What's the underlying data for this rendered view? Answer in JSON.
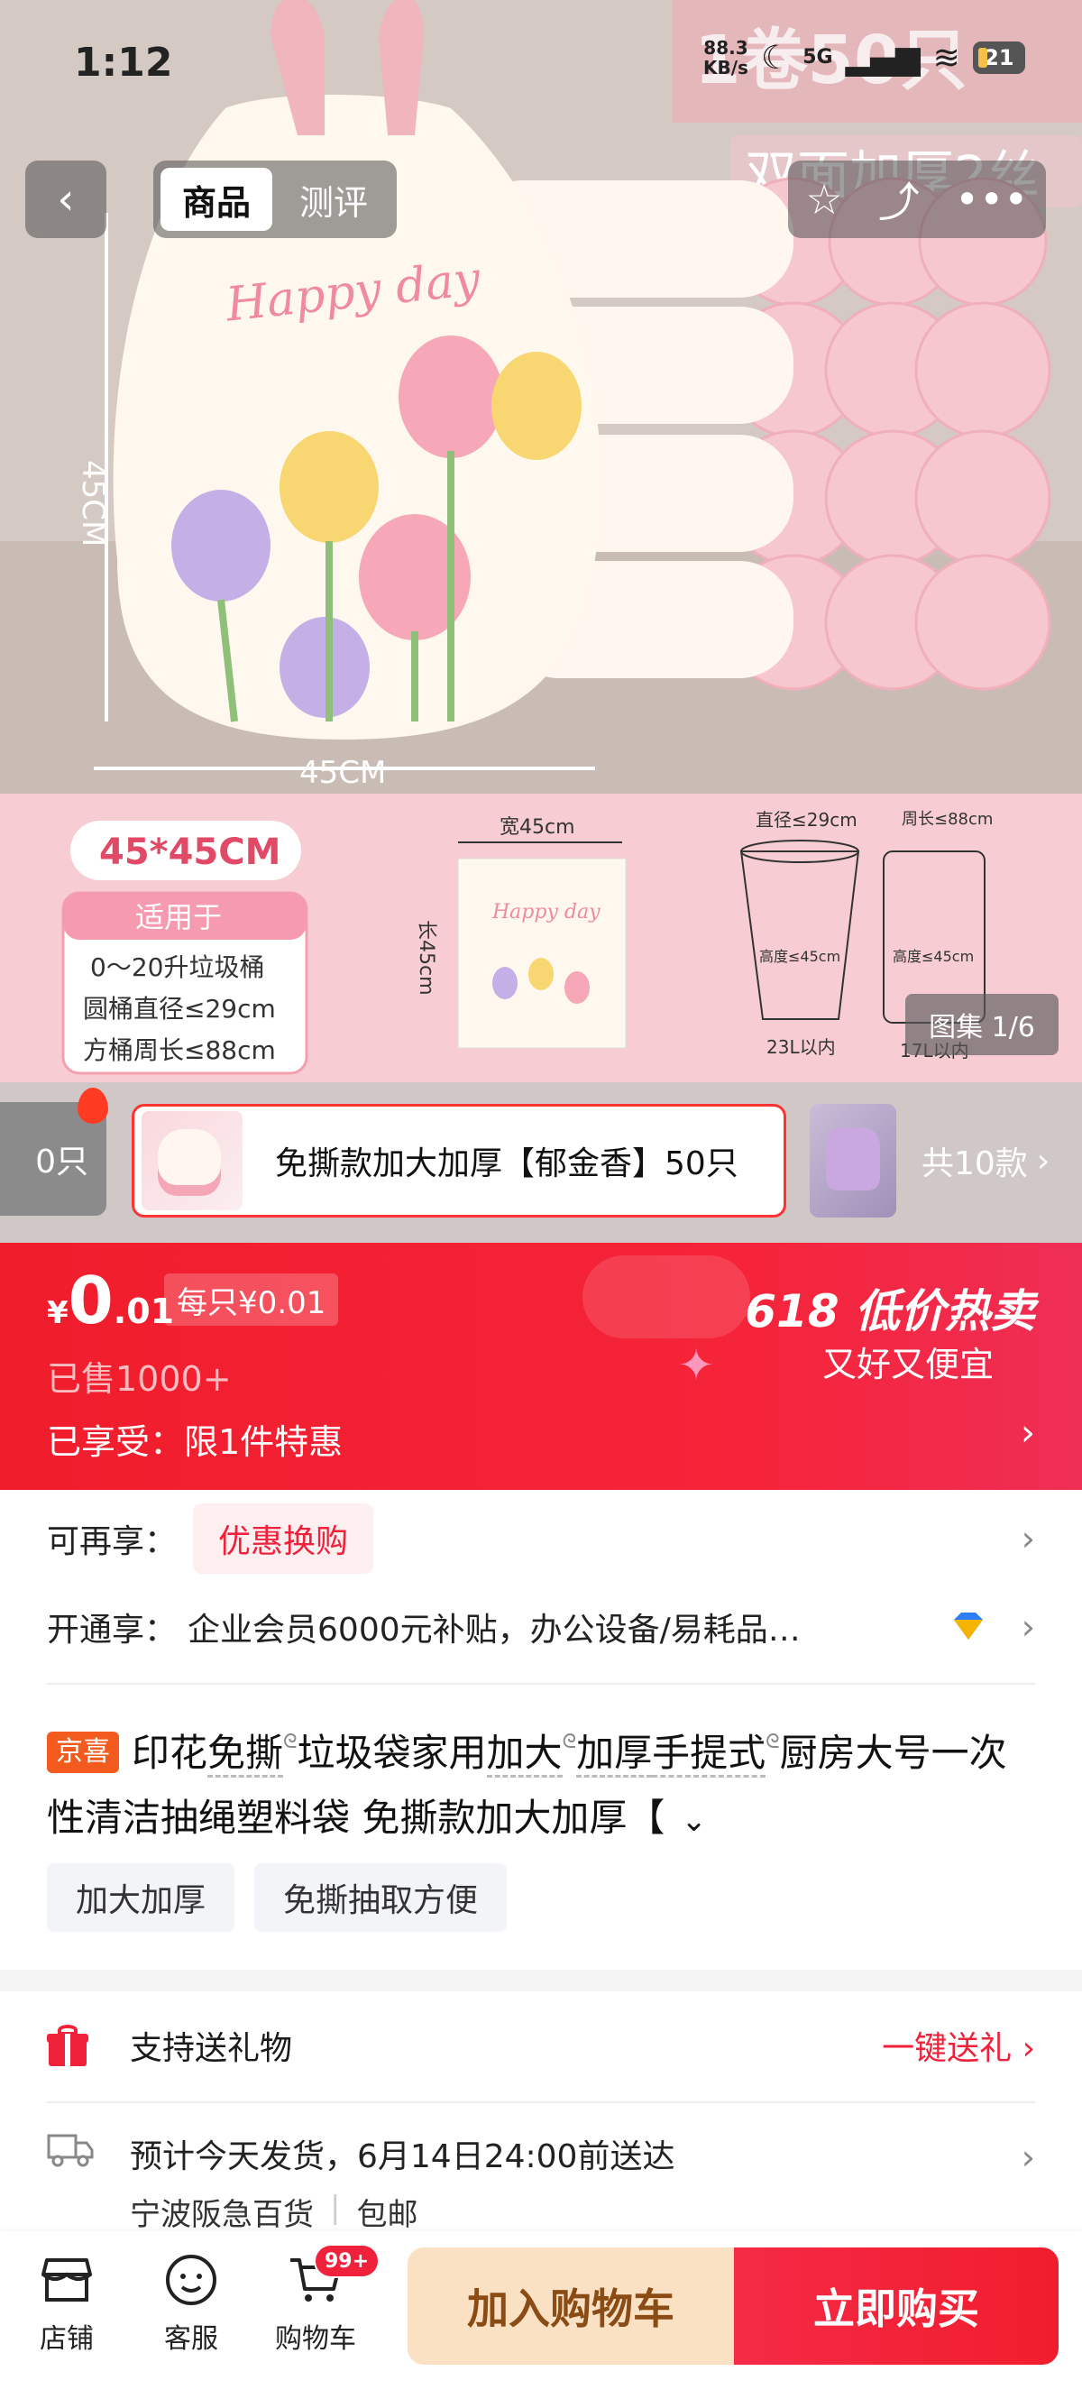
{
  "status_bar": {
    "time": "1:12",
    "net_speed_value": "88.3",
    "net_speed_unit": "KB/s",
    "network": "5G",
    "battery": "21"
  },
  "nav": {
    "tabs": [
      {
        "label": "商品",
        "active": true
      },
      {
        "label": "测评",
        "active": false
      }
    ]
  },
  "hero": {
    "overlay_text_top": "1卷50只",
    "overlay_text_sub": "双面加厚2丝",
    "bag_print": "Happy day",
    "height_dim": "45CM",
    "width_dim": "45CM",
    "spec": {
      "size": "45*45CM",
      "applies_title": "适用于",
      "applies_lines": [
        "0～20升垃圾桶",
        "圆桶直径≤29cm",
        "方桶周长≤88cm"
      ],
      "bag_width": "宽45cm",
      "bag_length": "长45cm",
      "round_diameter": "直径≤29cm",
      "round_height": "高度≤45cm",
      "round_volume": "23L以内",
      "square_perimeter": "周长≤88cm",
      "square_height": "高度≤45cm",
      "square_volume": "17L以内"
    },
    "gallery_counter": "图集 1/6"
  },
  "sku": {
    "prev_label": "0只",
    "current_label": "免撕款加大加厚【郁金香】50只",
    "total_label": "共10款"
  },
  "price": {
    "currency": "¥",
    "integer": "0",
    "decimal": ".01",
    "unit_price": "每只¥0.01",
    "sold": "已售1000+",
    "promo_title": "618 低价热卖",
    "promo_subtitle": "又好又便宜",
    "enjoyed": "已享受：限1件特惠"
  },
  "benefits": [
    {
      "label": "可再享：",
      "tag": "优惠换购"
    },
    {
      "label": "开通享：",
      "text": "企业会员6000元补贴，办公设备/易耗品…"
    }
  ],
  "title": {
    "badge": "京喜",
    "parts": [
      "印花",
      "免撕",
      "垃圾袋家用",
      "加大",
      "加厚",
      "手提式",
      "厨房大号一次性清洁抽绳塑料袋 免撕款加大加厚【"
    ]
  },
  "feature_tags": [
    "加大加厚",
    "免撕抽取方便"
  ],
  "gift": {
    "label": "支持送礼物",
    "action": "一键送礼"
  },
  "shipping": {
    "estimate": "预计今天发货，6月14日24:00前送达",
    "store": "宁波阪急百货",
    "postage": "包邮"
  },
  "bottom_bar": {
    "store": "店铺",
    "service": "客服",
    "cart": "购物车",
    "cart_badge": "99+",
    "add_to_cart": "加入购物车",
    "buy_now": "立即购买"
  },
  "colors": {
    "brand_red": "#f01d2c",
    "cart_button_bg": "#fbe1c4",
    "badge_orange": "#f25a1e"
  }
}
